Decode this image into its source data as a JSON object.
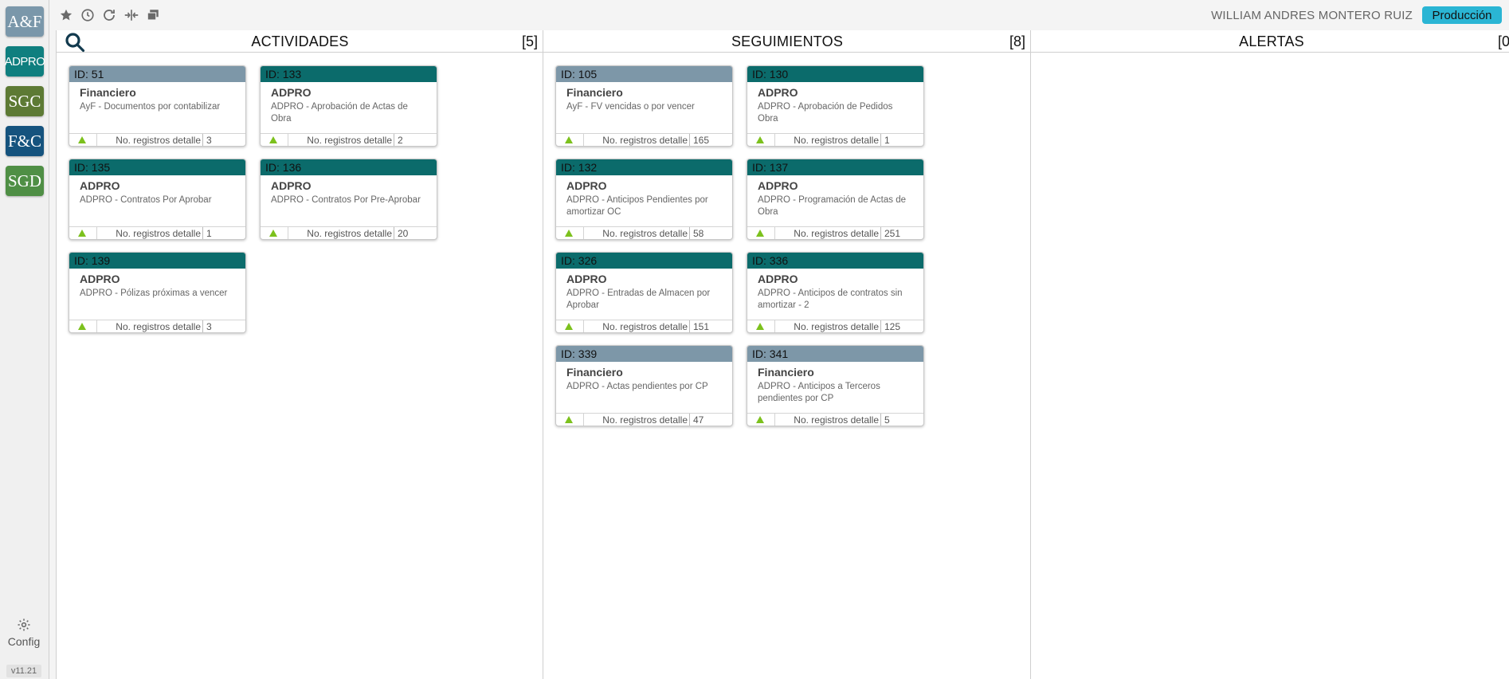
{
  "apps": [
    {
      "label": "A&F",
      "color": "#7a97aa"
    },
    {
      "label": "ADPRO",
      "color": "#0f7f7f"
    },
    {
      "label": "SGC",
      "color": "#5d7a34"
    },
    {
      "label": "F&C",
      "color": "#15537e"
    },
    {
      "label": "SGD",
      "color": "#4f8f45"
    }
  ],
  "sidebar": {
    "config_label": "Config",
    "version": "v11.21"
  },
  "toolbar": {
    "icons": [
      "star-icon",
      "history-icon",
      "refresh-icon",
      "split-columns-icon",
      "windows-icon"
    ]
  },
  "header": {
    "user": "WILLIAM ANDRES MONTERO RUIZ",
    "environment": "Producción"
  },
  "columns": {
    "actividades": {
      "title": "ACTIVIDADES",
      "count": "[5]"
    },
    "seguimientos": {
      "title": "SEGUIMIENTOS",
      "count": "[8]"
    },
    "alertas": {
      "title": "ALERTAS",
      "count": "[0"
    }
  },
  "card_footer_label": "No. registros detalle",
  "cards": {
    "c51": {
      "id": "ID: 51",
      "category": "Financiero",
      "desc": "AyF - Documentos por contabilizar",
      "count": "3",
      "header_color": "gray"
    },
    "c133": {
      "id": "ID: 133",
      "category": "ADPRO",
      "desc": "ADPRO - Aprobación de Actas de Obra",
      "count": "2",
      "header_color": "teal"
    },
    "c135": {
      "id": "ID: 135",
      "category": "ADPRO",
      "desc": "ADPRO - Contratos Por Aprobar",
      "count": "1",
      "header_color": "teal"
    },
    "c136": {
      "id": "ID: 136",
      "category": "ADPRO",
      "desc": "ADPRO - Contratos Por Pre-Aprobar",
      "count": "20",
      "header_color": "teal"
    },
    "c139": {
      "id": "ID: 139",
      "category": "ADPRO",
      "desc": "ADPRO - Pólizas próximas a vencer",
      "count": "3",
      "header_color": "teal"
    },
    "c105": {
      "id": "ID: 105",
      "category": "Financiero",
      "desc": "AyF - FV vencidas o por vencer",
      "count": "165",
      "header_color": "gray"
    },
    "c130": {
      "id": "ID: 130",
      "category": "ADPRO",
      "desc": "ADPRO - Aprobación de Pedidos Obra",
      "count": "1",
      "header_color": "teal"
    },
    "c132": {
      "id": "ID: 132",
      "category": "ADPRO",
      "desc": "ADPRO - Anticipos Pendientes por amortizar OC",
      "count": "58",
      "header_color": "teal"
    },
    "c137": {
      "id": "ID: 137",
      "category": "ADPRO",
      "desc": "ADPRO - Programación de Actas de Obra",
      "count": "251",
      "header_color": "teal"
    },
    "c326": {
      "id": "ID: 326",
      "category": "ADPRO",
      "desc": "ADPRO - Entradas de Almacen por Aprobar",
      "count": "151",
      "header_color": "teal"
    },
    "c336": {
      "id": "ID: 336",
      "category": "ADPRO",
      "desc": "ADPRO - Anticipos de contratos sin amortizar - 2",
      "count": "125",
      "header_color": "teal"
    },
    "c339": {
      "id": "ID: 339",
      "category": "Financiero",
      "desc": "ADPRO - Actas pendientes por CP",
      "count": "47",
      "header_color": "gray"
    },
    "c341": {
      "id": "ID: 341",
      "category": "Financiero",
      "desc": "ADPRO - Anticipos a Terceros pendientes por CP",
      "count": "5",
      "header_color": "gray"
    }
  }
}
